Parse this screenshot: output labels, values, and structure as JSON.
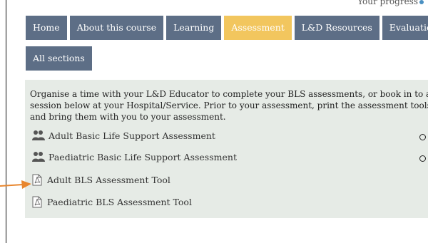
{
  "progress": {
    "label": "Your progress"
  },
  "nav": {
    "tabs": [
      {
        "label": "Home"
      },
      {
        "label": "About this course"
      },
      {
        "label": "Learning"
      },
      {
        "label": "Assessment"
      },
      {
        "label": "L&D Resources"
      },
      {
        "label": "Evaluation"
      }
    ],
    "active_tab": "Assessment",
    "all_sections": "All sections"
  },
  "content": {
    "intro": "Organise a time with your L&D Educator to complete your BLS assessments, or book in to a session below at your Hospital/Service. Prior to your assessment, print the assessment tools and bring them with you to your assessment.",
    "items": [
      {
        "label": "Adult Basic Life Support Assessment",
        "icon": "group-icon"
      },
      {
        "label": "Paediatric Basic Life Support Assessment",
        "icon": "group-icon"
      },
      {
        "label": "Adult BLS Assessment Tool",
        "icon": "pdf-icon"
      },
      {
        "label": "Paediatric BLS Assessment Tool",
        "icon": "pdf-icon"
      }
    ]
  },
  "colors": {
    "tab": "#5d6e86",
    "active_tab": "#f2c65e",
    "panel": "#e6ebe6",
    "arrow": "#e8862e"
  }
}
